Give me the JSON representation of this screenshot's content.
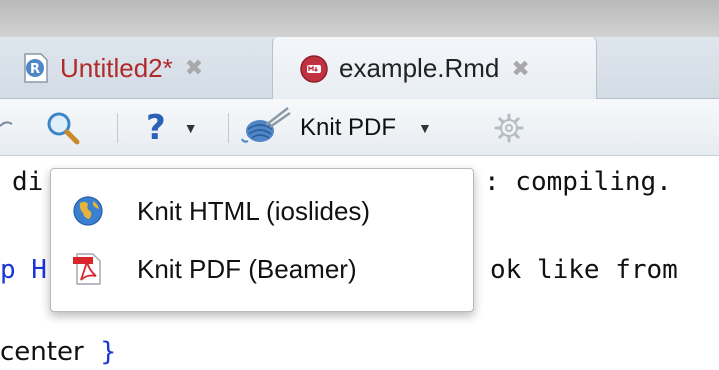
{
  "tabs": [
    {
      "label": "Untitled2*",
      "icon": "r-script-icon",
      "active": false
    },
    {
      "label": "example.Rmd",
      "icon": "rmarkdown-icon",
      "active": true
    }
  ],
  "toolbar": {
    "help_label": "?",
    "knit_label": "Knit PDF"
  },
  "editor": {
    "line1_start": "di",
    "line1_end": ": compiling.",
    "line2_start": "p H",
    "line2_end": "ok like from ",
    "line3_text": "center",
    "line3_brace": "}"
  },
  "menu": {
    "items": [
      {
        "label": "Knit HTML (ioslides)",
        "icon": "globe-icon"
      },
      {
        "label": "Knit PDF (Beamer)",
        "icon": "pdf-icon"
      }
    ]
  },
  "colors": {
    "modified_tab": "#b02a2a",
    "code_keyword": "#1b35d6"
  }
}
